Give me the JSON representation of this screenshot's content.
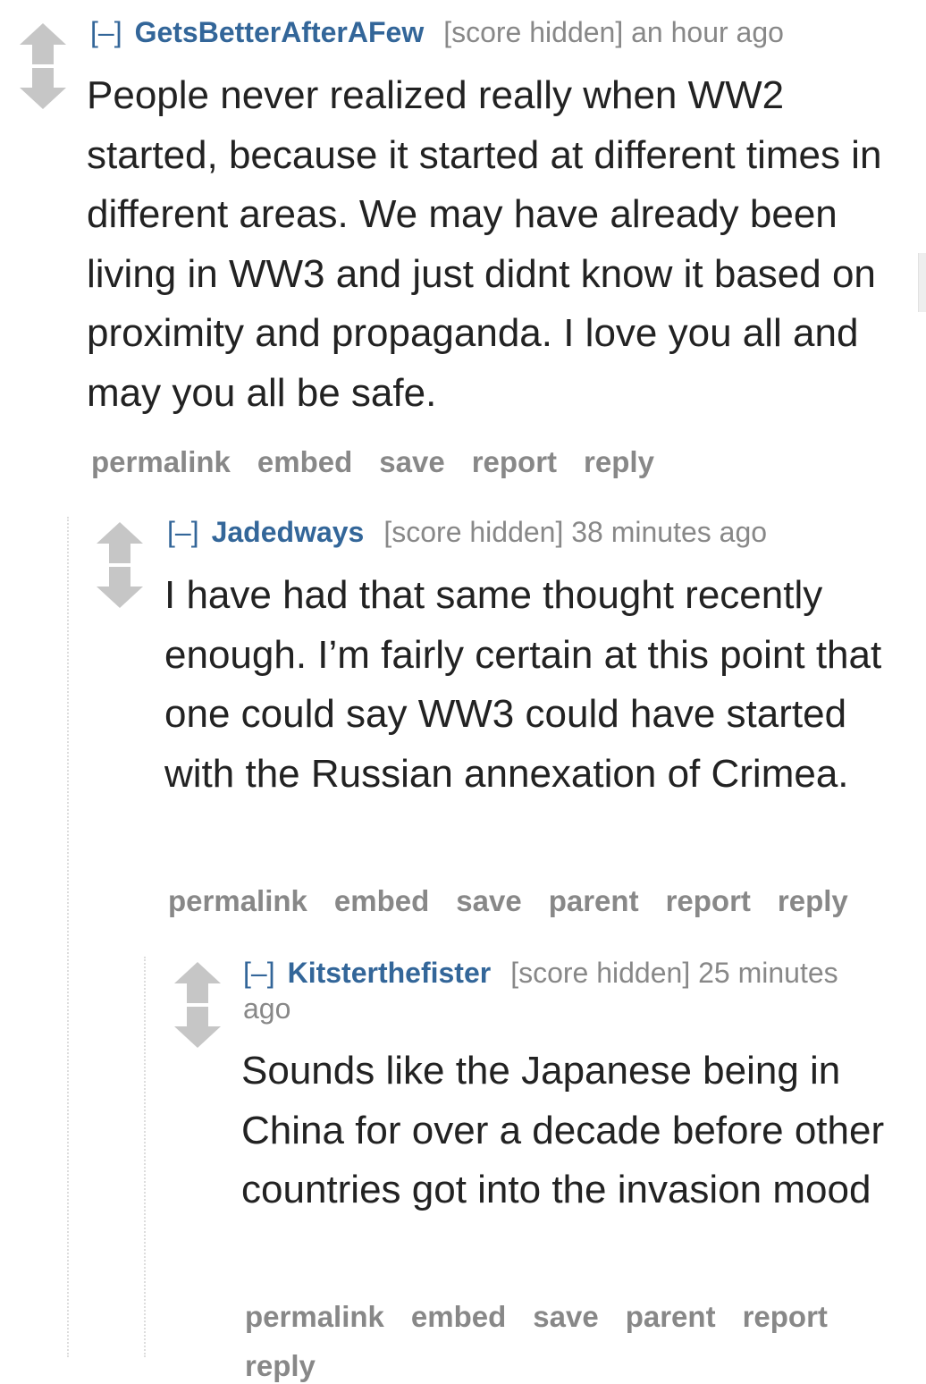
{
  "comments": [
    {
      "expand": "[–]",
      "author": "GetsBetterAfterAFew",
      "score": "[score hidden]",
      "time": "an hour ago",
      "body": "People never realized really when WW2 started, because it started at different times in different areas. We may have already been living in WW3 and just didnt know it based on proximity and propaganda. I love you all and may you all be safe.",
      "buttons": [
        "permalink",
        "embed",
        "save",
        "report",
        "reply"
      ]
    },
    {
      "expand": "[–]",
      "author": "Jadedways",
      "score": "[score hidden]",
      "time": "38 minutes ago",
      "body": "I have had that same thought recently enough. I’m fairly certain at this point that one could say WW3 could have started with the Russian annexation of Crimea.",
      "buttons": [
        "permalink",
        "embed",
        "save",
        "parent",
        "report",
        "reply"
      ]
    },
    {
      "expand": "[–]",
      "author": "Kitsterthefister",
      "score": "[score hidden]",
      "time": "25 minutes ago",
      "body": "Sounds like the Japanese being in China for over a decade before other countries got into the invasion mood",
      "buttons": [
        "permalink",
        "embed",
        "save",
        "parent",
        "report",
        "reply"
      ]
    }
  ],
  "colors": {
    "link": "#336699",
    "muted": "#888888",
    "arrow": "#c6c6c6",
    "text": "#222222"
  }
}
